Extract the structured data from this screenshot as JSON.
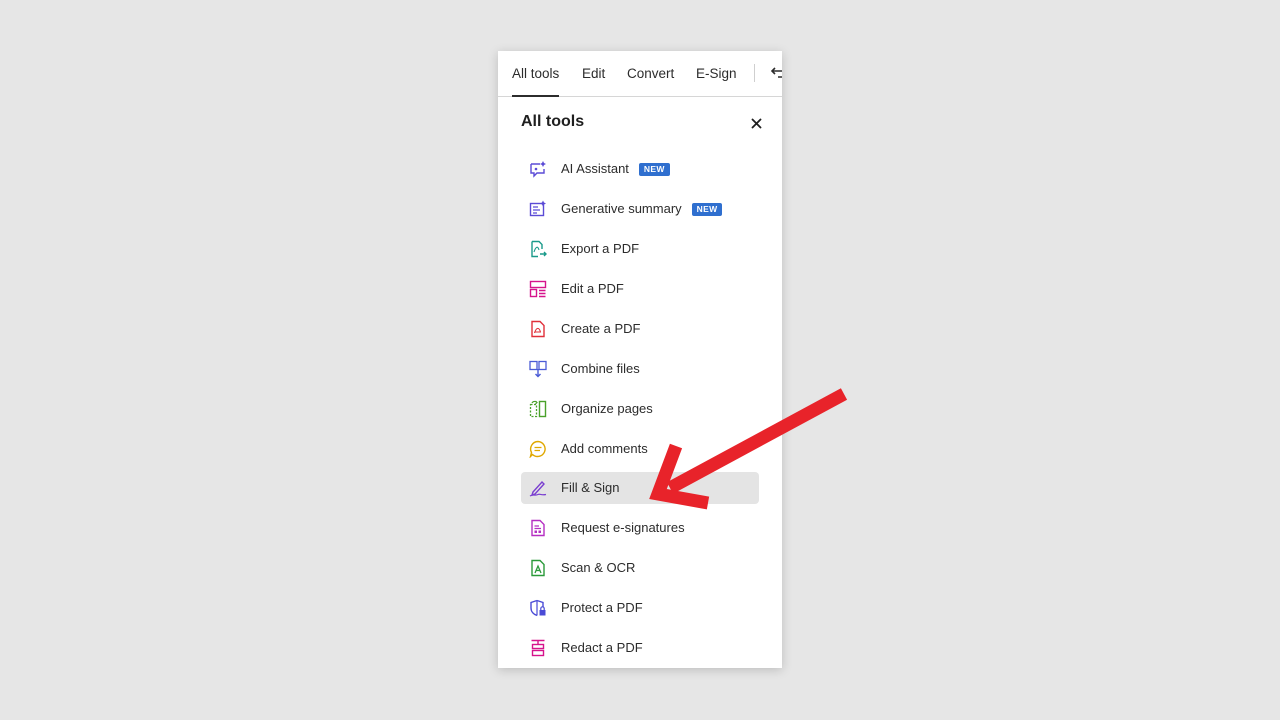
{
  "tabs": [
    {
      "label": "All tools",
      "active": true
    },
    {
      "label": "Edit",
      "active": false
    },
    {
      "label": "Convert",
      "active": false
    },
    {
      "label": "E-Sign",
      "active": false
    }
  ],
  "panel": {
    "title": "All tools",
    "close_icon": "close-icon",
    "undo_icon": "undo-icon"
  },
  "tools": [
    {
      "label": "AI Assistant",
      "badge": "NEW",
      "icon": "ai-assistant-icon",
      "color": "#5b4bd6"
    },
    {
      "label": "Generative summary",
      "badge": "NEW",
      "icon": "generative-summary-icon",
      "color": "#5b4bd6"
    },
    {
      "label": "Export a PDF",
      "icon": "export-pdf-icon",
      "color": "#1a9a8a"
    },
    {
      "label": "Edit a PDF",
      "icon": "edit-pdf-icon",
      "color": "#d6138c"
    },
    {
      "label": "Create a PDF",
      "icon": "create-pdf-icon",
      "color": "#e0303a"
    },
    {
      "label": "Combine files",
      "icon": "combine-files-icon",
      "color": "#4a5bd6"
    },
    {
      "label": "Organize pages",
      "icon": "organize-pages-icon",
      "color": "#4aa12a"
    },
    {
      "label": "Add comments",
      "icon": "add-comments-icon",
      "color": "#e0a800"
    },
    {
      "label": "Fill & Sign",
      "icon": "fill-sign-icon",
      "color": "#7a3fd0",
      "selected": true
    },
    {
      "label": "Request e-signatures",
      "icon": "request-esignatures-icon",
      "color": "#b52fc2"
    },
    {
      "label": "Scan & OCR",
      "icon": "scan-ocr-icon",
      "color": "#2a9a3a"
    },
    {
      "label": "Protect a PDF",
      "icon": "protect-pdf-icon",
      "color": "#4a4bd6"
    },
    {
      "label": "Redact a PDF",
      "icon": "redact-pdf-icon",
      "color": "#d6138c"
    }
  ],
  "colors": {
    "badge": "#2f6fcf",
    "selected_bg": "#e4e4e4",
    "annotation_arrow": "#e8232a"
  }
}
